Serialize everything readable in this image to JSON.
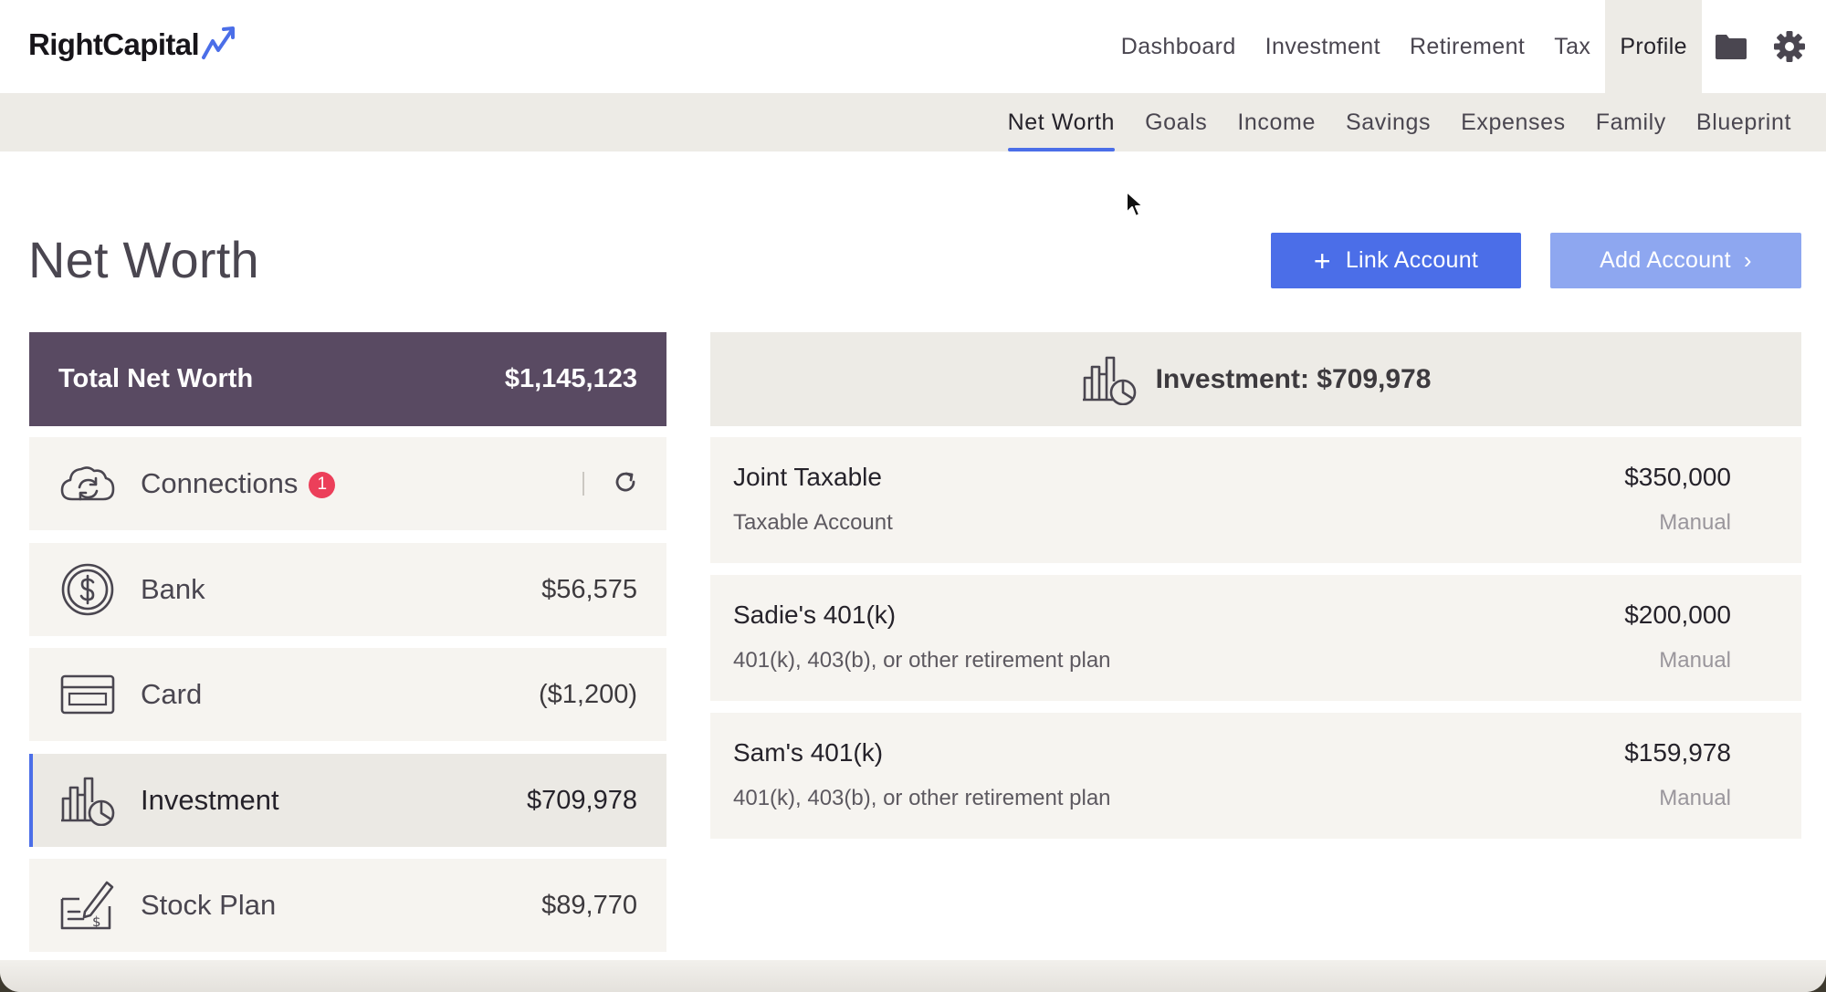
{
  "brand": {
    "name": "RightCapital",
    "accent": "#4b6ee8",
    "dark": "#594a62"
  },
  "topnav": {
    "items": [
      {
        "label": "Dashboard",
        "active": false
      },
      {
        "label": "Investment",
        "active": false
      },
      {
        "label": "Retirement",
        "active": false
      },
      {
        "label": "Tax",
        "active": false
      },
      {
        "label": "Profile",
        "active": true
      }
    ],
    "icons": [
      "folder-icon",
      "gear-icon"
    ]
  },
  "subnav": {
    "items": [
      {
        "label": "Net Worth",
        "active": true
      },
      {
        "label": "Goals",
        "active": false
      },
      {
        "label": "Income",
        "active": false
      },
      {
        "label": "Savings",
        "active": false
      },
      {
        "label": "Expenses",
        "active": false
      },
      {
        "label": "Family",
        "active": false
      },
      {
        "label": "Blueprint",
        "active": false
      }
    ]
  },
  "page": {
    "title": "Net Worth",
    "link_account": "Link Account",
    "add_account": "Add Account"
  },
  "summary": {
    "total_label": "Total Net Worth",
    "total_value": "$1,145,123",
    "categories": [
      {
        "label": "Connections",
        "badge": "1",
        "icon": "cloud-sync-icon"
      },
      {
        "label": "Bank",
        "value": "$56,575",
        "icon": "dollar-coin-icon"
      },
      {
        "label": "Card",
        "value": "($1,200)",
        "icon": "credit-card-icon"
      },
      {
        "label": "Investment",
        "value": "$709,978",
        "icon": "investment-chart-icon",
        "active": true
      },
      {
        "label": "Stock Plan",
        "value": "$89,770",
        "icon": "stock-plan-icon"
      }
    ]
  },
  "detail": {
    "title": "Investment: $709,978",
    "accounts": [
      {
        "name": "Joint Taxable",
        "value": "$350,000",
        "type": "Taxable Account",
        "source": "Manual"
      },
      {
        "name": "Sadie's 401(k)",
        "value": "$200,000",
        "type": "401(k), 403(b), or other retirement plan",
        "source": "Manual"
      },
      {
        "name": "Sam's 401(k)",
        "value": "$159,978",
        "type": "401(k), 403(b), or other retirement plan",
        "source": "Manual"
      }
    ]
  }
}
